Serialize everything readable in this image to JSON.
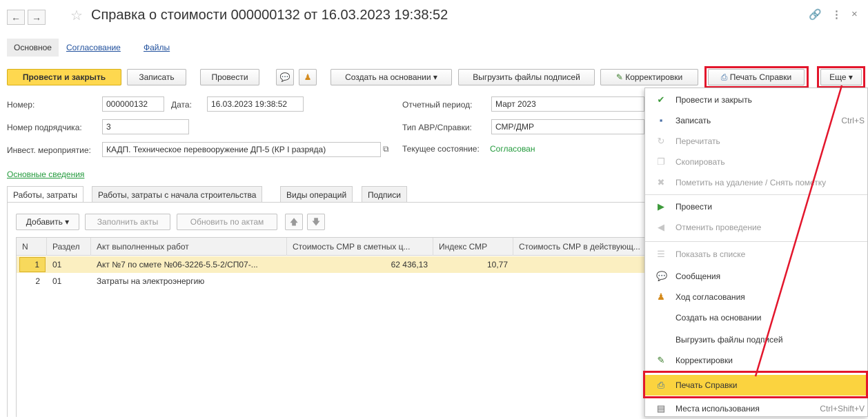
{
  "window": {
    "title": "Справка о стоимости 000000132 от 16.03.2023 19:38:52",
    "back": "←",
    "forward": "→",
    "star": "☆",
    "link_icon": "🔗",
    "more_icon": "⋮",
    "close_icon": "×"
  },
  "section_tabs": [
    "Основное",
    "Согласование",
    "Файлы"
  ],
  "toolbar": {
    "post_close": "Провести и закрыть",
    "save": "Записать",
    "post": "Провести",
    "create_basis": "Создать на основании",
    "upload_signatures": "Выгрузить файлы подписей",
    "corrections": "Корректировки",
    "print": "Печать Справки",
    "more": "Еще"
  },
  "form": {
    "number_label": "Номер:",
    "number_value": "000000132",
    "date_label": "Дата:",
    "date_value": "16.03.2023 19:38:52",
    "contractor_no_label": "Номер подрядчика:",
    "contractor_no_value": "3",
    "investment_label": "Инвест. мероприятие:",
    "investment_value": "КАДП. Техническое перевооружение ДП-5 (КР I разряда)",
    "period_label": "Отчетный период:",
    "period_value": "Март 2023",
    "type_label": "Тип АВР/Справки:",
    "type_value": "СМР/ДМР",
    "state_label": "Текущее состояние:",
    "state_value": "Согласован",
    "main_info_link": "Основные сведения"
  },
  "inner_tabs": [
    "Работы, затраты",
    "Работы, затраты с начала строительства",
    "Виды операций",
    "Подписи"
  ],
  "table_toolbar": {
    "add": "Добавить",
    "fill_acts": "Заполнить акты",
    "update_by_acts": "Обновить по актам"
  },
  "table": {
    "headers": [
      "N",
      "Раздел",
      "Акт выполненных работ",
      "Стоимость СМР в сметных ц...",
      "Индекс СМР",
      "Стоимость СМР в действующ..."
    ],
    "rows": [
      {
        "n": "1",
        "section": "01",
        "act": "Акт №7 по смете №06-3226-5.5-2/СП07-...",
        "cost": "62 436,13",
        "index": "10,77",
        "cost_current": ""
      },
      {
        "n": "2",
        "section": "01",
        "act": "Затраты на электроэнергию",
        "cost": "",
        "index": "",
        "cost_current": ""
      }
    ]
  },
  "menu": {
    "items": [
      {
        "label": "Провести и закрыть",
        "icon": "✔",
        "shortcut": "",
        "disabled": false
      },
      {
        "label": "Записать",
        "icon": "▪",
        "shortcut": "Ctrl+S",
        "disabled": false
      },
      {
        "label": "Перечитать",
        "icon": "↻",
        "shortcut": "",
        "disabled": true
      },
      {
        "label": "Скопировать",
        "icon": "❐",
        "shortcut": "",
        "disabled": true
      },
      {
        "label": "Пометить на удаление / Снять пометку",
        "icon": "✖",
        "shortcut": "",
        "disabled": true
      },
      {
        "label": "Провести",
        "icon": "▶",
        "shortcut": "",
        "disabled": false
      },
      {
        "label": "Отменить проведение",
        "icon": "◀",
        "shortcut": "",
        "disabled": true
      },
      {
        "label": "Показать в списке",
        "icon": "☰",
        "shortcut": "",
        "disabled": true
      },
      {
        "label": "Сообщения",
        "icon": "💬",
        "shortcut": "",
        "disabled": false
      },
      {
        "label": "Ход согласования",
        "icon": "♟",
        "shortcut": "",
        "disabled": false
      },
      {
        "label": "Создать на основании",
        "icon": "",
        "shortcut": "",
        "disabled": false
      },
      {
        "label": "Выгрузить файлы подписей",
        "icon": "",
        "shortcut": "",
        "disabled": false
      },
      {
        "label": "Корректировки",
        "icon": "✎",
        "shortcut": "",
        "disabled": false
      },
      {
        "label": "Печать Справки",
        "icon": "⎙",
        "shortcut": "",
        "disabled": false
      },
      {
        "label": "Места использования",
        "icon": "▤",
        "shortcut": "Ctrl+Shift+V",
        "disabled": false
      }
    ]
  },
  "colors": {
    "accent_yellow": "#fed84f",
    "highlight_red": "#e3162c",
    "link_green": "#239a3c"
  }
}
